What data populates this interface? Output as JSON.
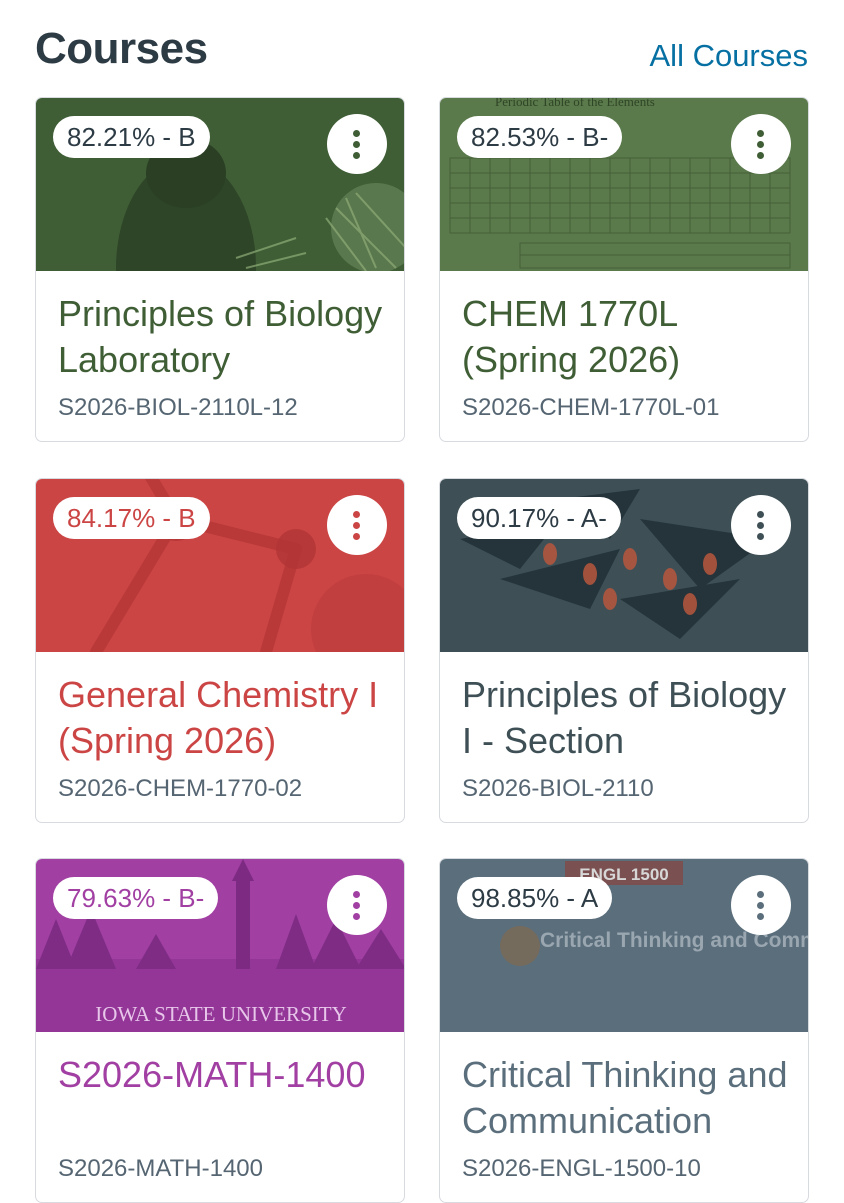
{
  "header": {
    "title": "Courses",
    "all_courses_label": "All Courses"
  },
  "courses": [
    {
      "grade": "82.21% - B",
      "title": "Principles of Biology Laboratory",
      "code": "S2026-BIOL-2110L-12",
      "color": "#3f5e35",
      "image": "hawk-pine-photo"
    },
    {
      "grade": "82.53% - B-",
      "title": "CHEM 1770L (Spring 2026)",
      "code": "S2026-CHEM-1770L-01",
      "color": "#5b7a4c",
      "image": "periodic-table-image",
      "image_text": "Periodic Table of the Elements"
    },
    {
      "grade": "84.17% - B",
      "title": "General Chemistry I (Spring 2026)",
      "code": "S2026-CHEM-1770-02",
      "color": "#cc4545",
      "image": "molecule-model-photo"
    },
    {
      "grade": "90.17% - A-",
      "title": "Principles of Biology I - Section",
      "code": "S2026-BIOL-2110",
      "color": "#3e5056",
      "image": "leaf-illustration"
    },
    {
      "grade": "79.63% - B-",
      "title": "S2026-MATH-1400",
      "code": "S2026-MATH-1400",
      "color": "#a13fa3",
      "image": "campus-photo",
      "image_text": "IOWA STATE UNIVERSITY"
    },
    {
      "grade": "98.85% - A",
      "title": "Critical Thinking and Communication",
      "code": "S2026-ENGL-1500-10",
      "color": "#5a6e7c",
      "image": "course-logo-image",
      "image_text": "Critical Thinking and Communication",
      "image_badge": "ENGL 1500"
    }
  ]
}
